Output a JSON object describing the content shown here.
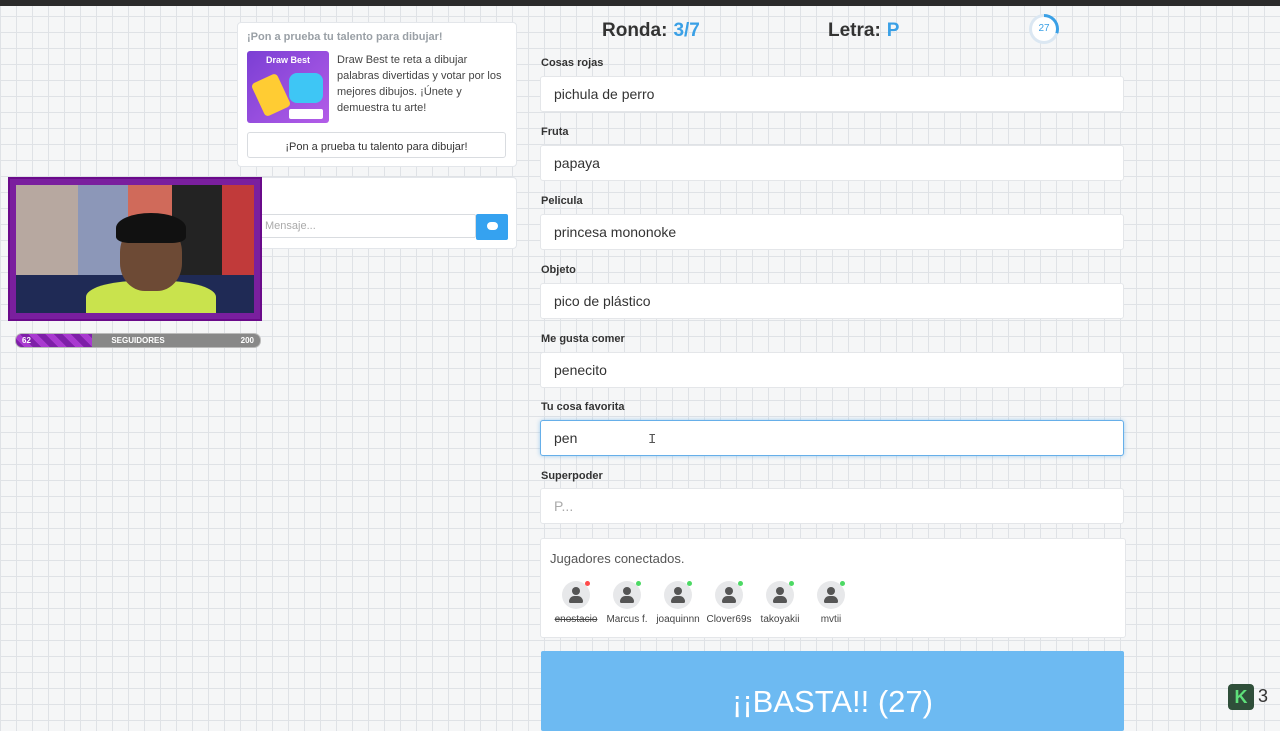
{
  "colors": {
    "accent": "#3aa0e6",
    "button": "#6dbaf2",
    "online": "#4cd964",
    "offline": "#ff4b4b",
    "stream_purple": "#7e1fa8"
  },
  "promo": {
    "title": "¡Pon a prueba tu talento para dibujar!",
    "thumb_label": "Draw Best",
    "description": "Draw Best te reta a dibujar palabras divertidas y votar por los mejores dibujos. ¡Únete y demuestra tu arte!",
    "button_label": "¡Pon a prueba tu talento para dibujar!"
  },
  "chat": {
    "placeholder": "Mensaje...",
    "send_icon": "chat-bubble-icon"
  },
  "stream_overlay": {
    "followers_label": "SEGUIDORES",
    "followers_current": "62",
    "followers_goal": "200",
    "followers_progress": 0.31
  },
  "header": {
    "round_label": "Ronda:",
    "round_value": "3/7",
    "letter_label": "Letra:",
    "letter_value": "P",
    "timer_value": "27",
    "timer_progress": 0.3
  },
  "categories": [
    {
      "label": "Cosas rojas",
      "value": "pichula de perro",
      "placeholder": ""
    },
    {
      "label": "Fruta",
      "value": "papaya",
      "placeholder": ""
    },
    {
      "label": "Pelicula",
      "value": "princesa mononoke",
      "placeholder": ""
    },
    {
      "label": "Objeto",
      "value": "pico de plástico",
      "placeholder": ""
    },
    {
      "label": "Me gusta comer",
      "value": "penecito",
      "placeholder": ""
    },
    {
      "label": "Tu cosa favorita",
      "value": "pen",
      "placeholder": ""
    },
    {
      "label": "Superpoder",
      "value": "",
      "placeholder": "P..."
    }
  ],
  "players": {
    "title": "Jugadores conectados.",
    "list": [
      {
        "name": "enostacio",
        "status": "offline"
      },
      {
        "name": "Marcus f.",
        "status": "online"
      },
      {
        "name": "joaquinnn",
        "status": "online"
      },
      {
        "name": "Clover69s",
        "status": "online"
      },
      {
        "name": "takoyakii",
        "status": "online"
      },
      {
        "name": "mvtii",
        "status": "online"
      }
    ]
  },
  "basta_button": "¡¡BASTA!! (27)",
  "corner_badge": {
    "icon": "kick-logo-icon",
    "letter": "K",
    "count": "3"
  }
}
